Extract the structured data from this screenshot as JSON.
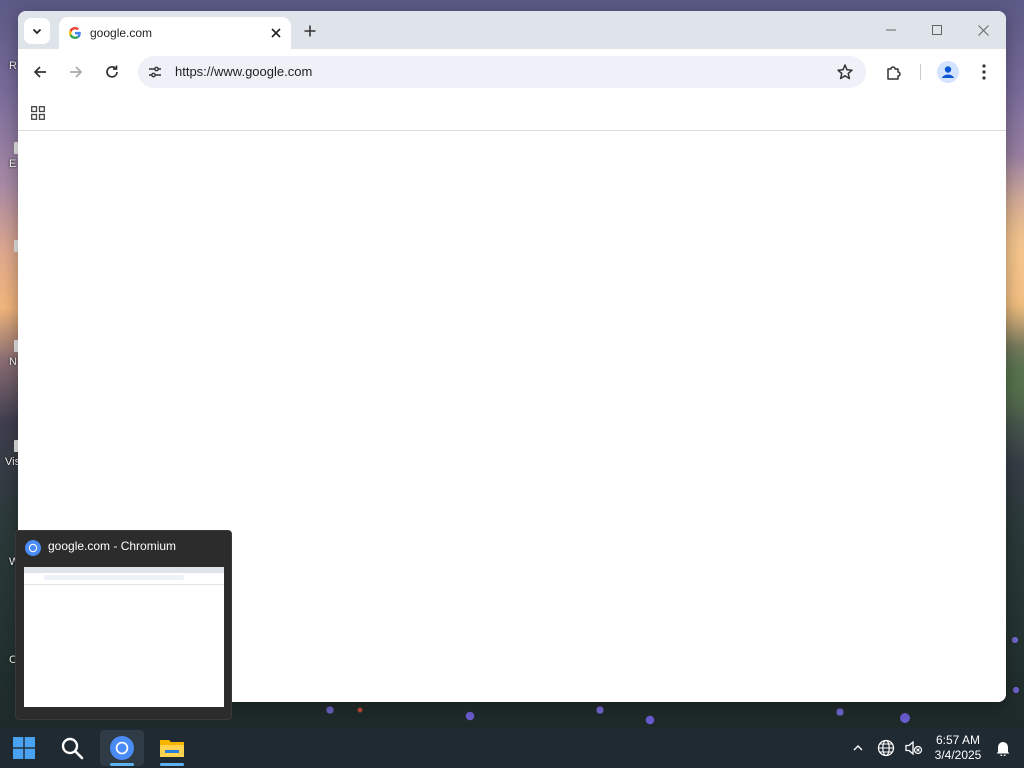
{
  "desktop": {
    "labels": [
      "R",
      "E",
      "N",
      "Vis",
      "W",
      "C"
    ]
  },
  "browser": {
    "tab": {
      "title": "google.com",
      "favicon": "google-g-icon"
    },
    "omnibox": {
      "url": "https://www.google.com"
    },
    "controls": [
      "minimize-icon",
      "maximize-icon",
      "close-icon"
    ],
    "colors": {
      "tabbar": "#dfe3ea",
      "omnibox": "#eef1f8"
    }
  },
  "taskbar_preview": {
    "title": "google.com - Chromium"
  },
  "taskbar": {
    "apps": [
      "start-icon",
      "search-icon",
      "chromium-icon",
      "file-explorer-icon"
    ],
    "clock": {
      "time": "6:57 AM",
      "date": "3/4/2025"
    },
    "colors": {
      "background": "#1f2a33",
      "active_indicator": "#5fb2f2"
    }
  }
}
